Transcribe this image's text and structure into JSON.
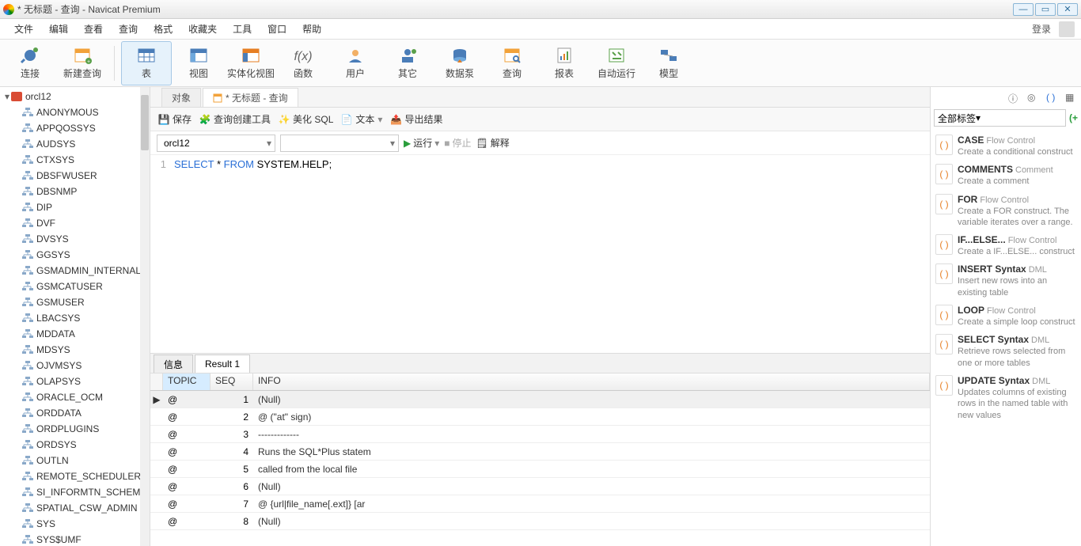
{
  "title": "* 无标题 - 查询 - Navicat Premium",
  "menu": [
    "文件",
    "编辑",
    "查看",
    "查询",
    "格式",
    "收藏夹",
    "工具",
    "窗口",
    "帮助"
  ],
  "login": "登录",
  "toolbar": [
    {
      "label": "连接",
      "icon": "plug"
    },
    {
      "label": "新建查询",
      "icon": "newquery"
    },
    {
      "label": "表",
      "icon": "table",
      "active": true
    },
    {
      "label": "视图",
      "icon": "view"
    },
    {
      "label": "实体化视图",
      "icon": "matview"
    },
    {
      "label": "函数",
      "icon": "fx"
    },
    {
      "label": "用户",
      "icon": "user"
    },
    {
      "label": "其它",
      "icon": "other"
    },
    {
      "label": "数据泵",
      "icon": "pump"
    },
    {
      "label": "查询",
      "icon": "query"
    },
    {
      "label": "报表",
      "icon": "report"
    },
    {
      "label": "自动运行",
      "icon": "auto"
    },
    {
      "label": "模型",
      "icon": "model"
    }
  ],
  "tree": {
    "root": "orcl12",
    "children": [
      "ANONYMOUS",
      "APPQOSSYS",
      "AUDSYS",
      "CTXSYS",
      "DBSFWUSER",
      "DBSNMP",
      "DIP",
      "DVF",
      "DVSYS",
      "GGSYS",
      "GSMADMIN_INTERNAL",
      "GSMCATUSER",
      "GSMUSER",
      "LBACSYS",
      "MDDATA",
      "MDSYS",
      "OJVMSYS",
      "OLAPSYS",
      "ORACLE_OCM",
      "ORDDATA",
      "ORDPLUGINS",
      "ORDSYS",
      "OUTLN",
      "REMOTE_SCHEDULER_",
      "SI_INFORMTN_SCHEM",
      "SPATIAL_CSW_ADMIN",
      "SYS",
      "SYS$UMF"
    ]
  },
  "tabs": {
    "obj": "对象",
    "query": "* 无标题 - 查询"
  },
  "qtool": {
    "save": "保存",
    "builder": "查询创建工具",
    "beautify": "美化 SQL",
    "text": "文本",
    "export": "导出结果"
  },
  "conn": {
    "db": "orcl12",
    "run": "运行",
    "stop": "停止",
    "explain": "解释"
  },
  "sql": {
    "line": "1",
    "kw1": "SELECT",
    "star": "*",
    "kw2": "FROM",
    "rest": "SYSTEM.HELP;"
  },
  "rtabs": {
    "info": "信息",
    "res": "Result 1"
  },
  "grid": {
    "cols": [
      "TOPIC",
      "SEQ",
      "INFO"
    ],
    "rows": [
      {
        "marker": "▶",
        "topic": "@",
        "seq": "1",
        "info": "(Null)",
        "null": true,
        "sel": true
      },
      {
        "marker": "",
        "topic": "@",
        "seq": "2",
        "info": "@ (\"at\" sign)"
      },
      {
        "marker": "",
        "topic": "@",
        "seq": "3",
        "info": "-------------"
      },
      {
        "marker": "",
        "topic": "@",
        "seq": "4",
        "info": "Runs the SQL*Plus statem"
      },
      {
        "marker": "",
        "topic": "@",
        "seq": "5",
        "info": "called from the local file"
      },
      {
        "marker": "",
        "topic": "@",
        "seq": "6",
        "info": "(Null)",
        "null": true
      },
      {
        "marker": "",
        "topic": "@",
        "seq": "7",
        "info": "@ {url|file_name[.ext]} [ar"
      },
      {
        "marker": "",
        "topic": "@",
        "seq": "8",
        "info": "(Null)",
        "null": true
      }
    ]
  },
  "rfilter": "全部标签",
  "snips": [
    {
      "title": "CASE",
      "cat": "Flow Control",
      "desc": "Create a conditional construct"
    },
    {
      "title": "COMMENTS",
      "cat": "Comment",
      "desc": "Create a comment"
    },
    {
      "title": "FOR",
      "cat": "Flow Control",
      "desc": "Create a FOR construct. The variable iterates over a range."
    },
    {
      "title": "IF...ELSE...",
      "cat": "Flow Control",
      "desc": "Create a IF...ELSE... construct"
    },
    {
      "title": "INSERT Syntax",
      "cat": "DML",
      "desc": "Insert new rows into an existing table"
    },
    {
      "title": "LOOP",
      "cat": "Flow Control",
      "desc": "Create a simple loop construct"
    },
    {
      "title": "SELECT Syntax",
      "cat": "DML",
      "desc": "Retrieve rows selected from one or more tables"
    },
    {
      "title": "UPDATE Syntax",
      "cat": "DML",
      "desc": "Updates columns of existing rows in the named table with new values"
    }
  ]
}
